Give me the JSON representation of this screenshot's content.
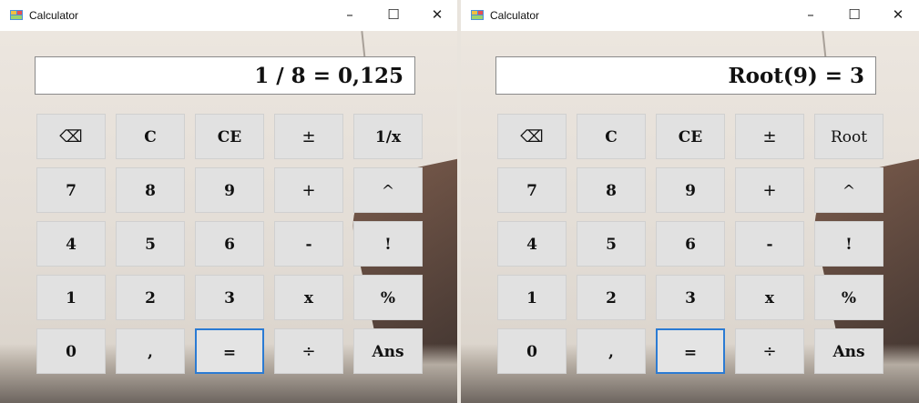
{
  "windows": [
    {
      "title": "Calculator",
      "controls": {
        "minimize": "–",
        "maximize": "☐",
        "close": "✕"
      },
      "display": "1 / 8 = 0,125",
      "keys": [
        [
          "⌫",
          "C",
          "CE",
          "±",
          "1/x"
        ],
        [
          "7",
          "8",
          "9",
          "+",
          "^"
        ],
        [
          "4",
          "5",
          "6",
          "-",
          "!"
        ],
        [
          "1",
          "2",
          "3",
          "x",
          "%"
        ],
        [
          "0",
          ",",
          "=",
          "÷",
          "Ans"
        ]
      ]
    },
    {
      "title": "Calculator",
      "controls": {
        "minimize": "–",
        "maximize": "☐",
        "close": "✕"
      },
      "display": "Root(9) = 3",
      "keys": [
        [
          "⌫",
          "C",
          "CE",
          "±",
          "Root"
        ],
        [
          "7",
          "8",
          "9",
          "+",
          "^"
        ],
        [
          "4",
          "5",
          "6",
          "-",
          "!"
        ],
        [
          "1",
          "2",
          "3",
          "x",
          "%"
        ],
        [
          "0",
          ",",
          "=",
          "÷",
          "Ans"
        ]
      ]
    }
  ],
  "colors": {
    "selected_border": "#2b7bd3",
    "key_bg": "#e1e1e1",
    "titlebar_bg": "#ffffff"
  },
  "icons": {
    "app": "calculator-app-icon",
    "backspace": "backspace-icon"
  }
}
